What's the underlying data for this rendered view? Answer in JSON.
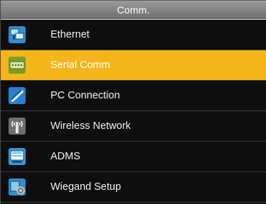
{
  "header": {
    "title": "Comm."
  },
  "menu": {
    "items": [
      {
        "label": "Ethernet",
        "icon": "ethernet-icon",
        "selected": false
      },
      {
        "label": "Serial Comm",
        "icon": "serial-comm-icon",
        "selected": true
      },
      {
        "label": "PC Connection",
        "icon": "pc-connection-icon",
        "selected": false
      },
      {
        "label": "Wireless Network",
        "icon": "wireless-network-icon",
        "selected": false
      },
      {
        "label": "ADMS",
        "icon": "adms-icon",
        "selected": false
      },
      {
        "label": "Wiegand Setup",
        "icon": "wiegand-setup-icon",
        "selected": false
      }
    ]
  },
  "colors": {
    "highlight": "#f4b51a",
    "background": "#0e0e0e",
    "header": "#8a8a8a"
  }
}
